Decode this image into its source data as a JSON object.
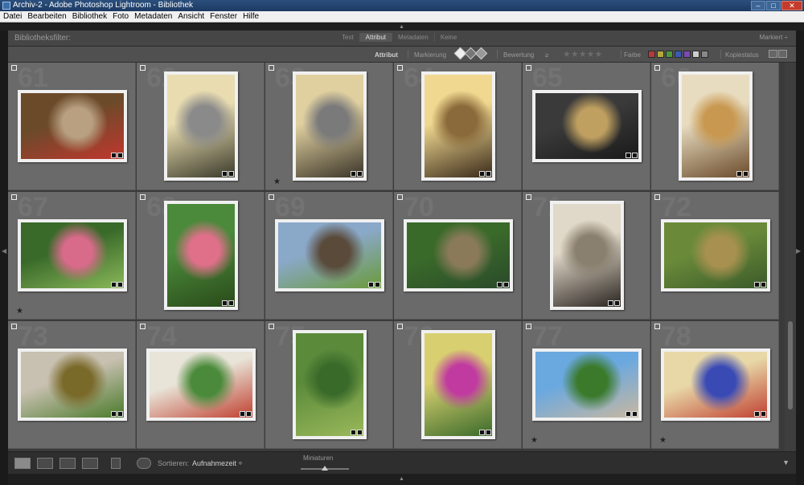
{
  "window": {
    "title": "Archiv-2 - Adobe Photoshop Lightroom - Bibliothek",
    "buttons": [
      "–",
      "□",
      "✕"
    ]
  },
  "menu": [
    "Datei",
    "Bearbeiten",
    "Bibliothek",
    "Foto",
    "Metadaten",
    "Ansicht",
    "Fenster",
    "Hilfe"
  ],
  "filter": {
    "label": "Bibliotheksfilter:",
    "tabs": [
      "Text",
      "Attribut",
      "Metadaten",
      "Keine"
    ],
    "active_tab": "Attribut",
    "preset": "Markiert ÷"
  },
  "attribute_bar": {
    "attribut": "Attribut",
    "markierung": "Markierung",
    "bewertung": "Bewertung",
    "bewertung_op": "≥",
    "stars": "★★★★★",
    "farbe": "Farbe",
    "color_labels": [
      "#b53a3a",
      "#b5a83a",
      "#4a9a3a",
      "#3a5ab5",
      "#7a4ab5",
      "#cccccc",
      "#888888"
    ],
    "kopiestatus": "Kopiestatus"
  },
  "grid": {
    "cells": [
      {
        "num": "61",
        "star": "",
        "colors": [
          "#6b4a2a",
          "#b8a080",
          "#c2372e"
        ]
      },
      {
        "num": "62",
        "star": "",
        "colors": [
          "#e8dcb0",
          "#8a8a8a",
          "#3a3a2a"
        ]
      },
      {
        "num": "63",
        "star": "★",
        "colors": [
          "#e0d0a0",
          "#7a7a7a",
          "#3a3428"
        ]
      },
      {
        "num": "64",
        "star": "",
        "colors": [
          "#f0d890",
          "#8a6a3a",
          "#3a2a1a"
        ]
      },
      {
        "num": "65",
        "star": "",
        "colors": [
          "#3a3a3a",
          "#c0a060",
          "#1a1a1a"
        ]
      },
      {
        "num": "66",
        "star": "",
        "colors": [
          "#e8dcc0",
          "#c89850",
          "#6a4a2a"
        ]
      },
      {
        "num": "67",
        "star": "★",
        "colors": [
          "#3a6a2a",
          "#d86a8a",
          "#8ab85a"
        ]
      },
      {
        "num": "68",
        "star": "",
        "colors": [
          "#4a8a3a",
          "#e0708a",
          "#2a4a1a"
        ]
      },
      {
        "num": "69",
        "star": "",
        "colors": [
          "#8aa8c8",
          "#5a4a3a",
          "#6a9a3a"
        ]
      },
      {
        "num": "70",
        "star": "",
        "colors": [
          "#3a6a2a",
          "#8a7a5a",
          "#2a4a2a"
        ]
      },
      {
        "num": "71",
        "star": "",
        "colors": [
          "#e0d8c8",
          "#8a8070",
          "#2a2420"
        ]
      },
      {
        "num": "72",
        "star": "",
        "colors": [
          "#6a8a3a",
          "#a89050",
          "#3a5a2a"
        ]
      },
      {
        "num": "73",
        "star": "",
        "colors": [
          "#c8c0b0",
          "#7a6a2a",
          "#4a7a2a"
        ]
      },
      {
        "num": "74",
        "star": "",
        "colors": [
          "#e8e4d8",
          "#4a8a3a",
          "#c04030"
        ]
      },
      {
        "num": "75",
        "star": "",
        "colors": [
          "#5a8a3a",
          "#3a6a2a",
          "#9ab85a"
        ]
      },
      {
        "num": "76",
        "star": "",
        "colors": [
          "#d8d070",
          "#c03aa0",
          "#3a6a2a"
        ]
      },
      {
        "num": "77",
        "star": "★",
        "colors": [
          "#6aa8e0",
          "#3a7a2a",
          "#c8b8a0"
        ]
      },
      {
        "num": "78",
        "star": "★",
        "colors": [
          "#e8d8a8",
          "#3a4ab5",
          "#c04030"
        ]
      }
    ]
  },
  "toolbar": {
    "sort_label": "Sortieren:",
    "sort_value": "Aufnahmezeit ÷",
    "thumb_label": "Miniaturen",
    "thumb_size": 0.5,
    "right_arrow": "▼"
  }
}
